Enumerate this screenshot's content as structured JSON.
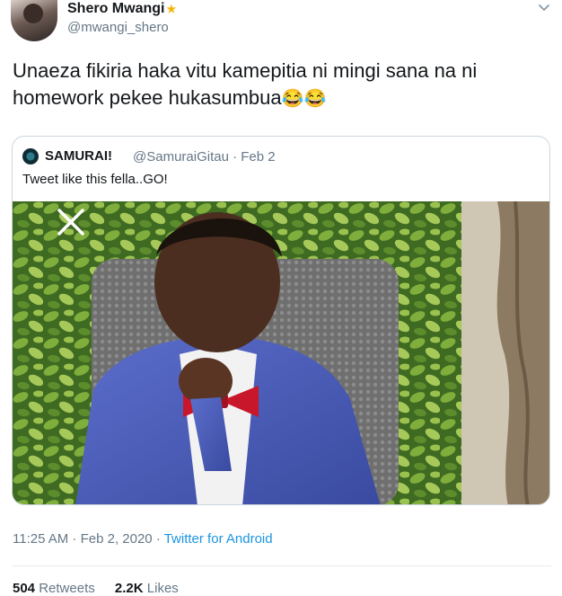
{
  "author": {
    "name": "Shero Mwangi",
    "name_emoji": "★",
    "handle": "@mwangi_shero"
  },
  "tweet": {
    "text": "Unaeza fikiria haka vitu kamepitia ni mingi sana na ni homework pekee hukasumbua",
    "emojis": "😂😂"
  },
  "quoted": {
    "name": "SAMURAI!",
    "handle_date": "@SamuraiGitau · Feb 2",
    "text": "Tweet like this fella..GO!"
  },
  "meta": {
    "time_date": "11:25 AM · Feb 2, 2020 · ",
    "source": "Twitter for Android"
  },
  "stats": {
    "retweets_count": "504",
    "retweets_label": "Retweets",
    "likes_count": "2.2K",
    "likes_label": "Likes"
  },
  "icons": {
    "caret": "chevron-down-icon",
    "image_overlay": "close-icon"
  },
  "colors": {
    "link": "#1b95e0",
    "secondary_text": "#657786",
    "primary_text": "#14171a",
    "border": "#ccd6dd"
  }
}
